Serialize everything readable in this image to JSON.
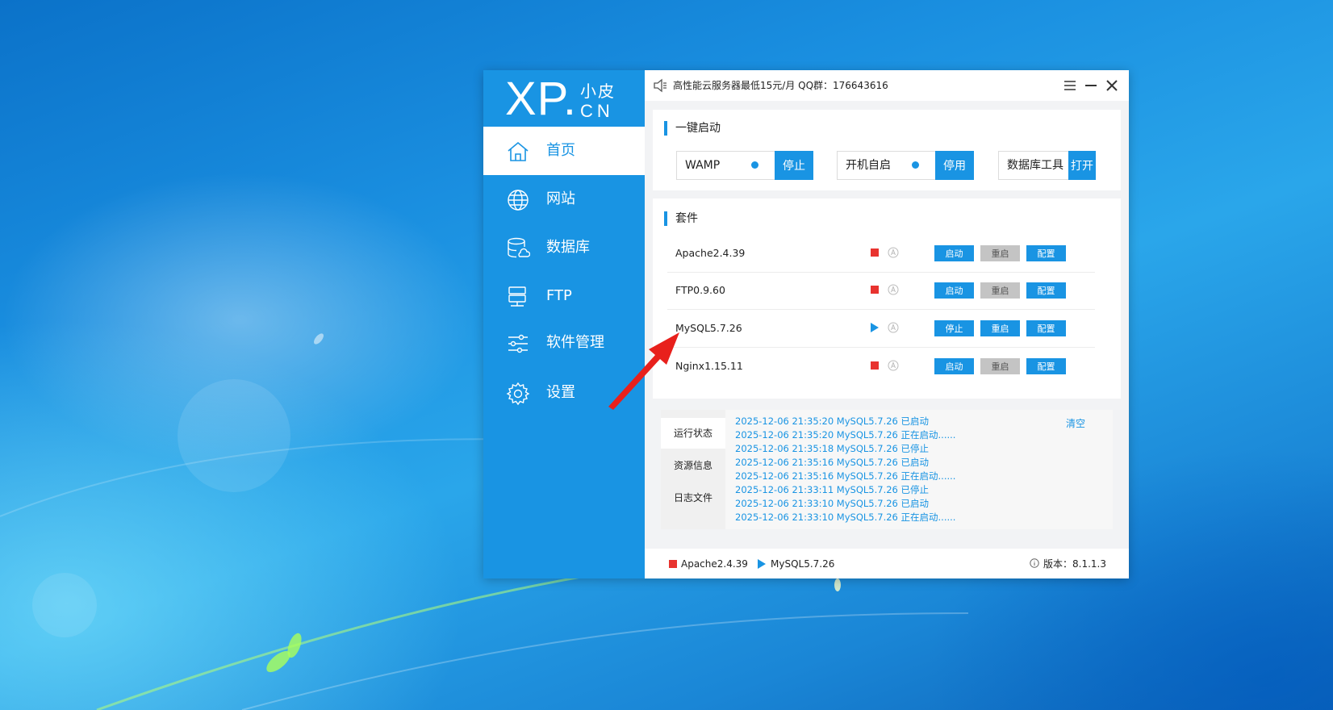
{
  "window": {
    "logo": {
      "main": "XP.",
      "top": "小皮",
      "bottom": "CN"
    },
    "notice": "高性能云服务器最低15元/月 QQ群：176643616"
  },
  "sidebar": {
    "items": [
      {
        "label": "首页",
        "icon": "home-icon",
        "active": true
      },
      {
        "label": "网站",
        "icon": "globe-icon"
      },
      {
        "label": "数据库",
        "icon": "database-icon"
      },
      {
        "label": "FTP",
        "icon": "ftp-icon"
      },
      {
        "label": "软件管理",
        "icon": "sliders-icon"
      },
      {
        "label": "设置",
        "icon": "gear-icon"
      }
    ]
  },
  "quick_start": {
    "title": "一键启动",
    "items": [
      {
        "label": "WAMP",
        "button": "停止"
      },
      {
        "label": "开机自启",
        "button": "停用"
      },
      {
        "label": "数据库工具",
        "button": "打开"
      }
    ]
  },
  "suite": {
    "title": "套件",
    "rows": [
      {
        "name": "Apache2.4.39",
        "status": "stopped",
        "b1": "启动",
        "b2": "重启",
        "b3": "配置"
      },
      {
        "name": "FTP0.9.60",
        "status": "stopped",
        "b1": "启动",
        "b2": "重启",
        "b3": "配置"
      },
      {
        "name": "MySQL5.7.26",
        "status": "running",
        "b1": "停止",
        "b2": "重启",
        "b3": "配置"
      },
      {
        "name": "Nginx1.15.11",
        "status": "stopped",
        "b1": "启动",
        "b2": "重启",
        "b3": "配置"
      }
    ]
  },
  "log": {
    "tabs": [
      "运行状态",
      "资源信息",
      "日志文件"
    ],
    "clear_label": "清空",
    "lines": [
      "2025-12-06 21:35:20 MySQL5.7.26 已启动",
      "2025-12-06 21:35:20 MySQL5.7.26 正在启动......",
      "2025-12-06 21:35:18 MySQL5.7.26 已停止",
      "2025-12-06 21:35:16 MySQL5.7.26 已启动",
      "2025-12-06 21:35:16 MySQL5.7.26 正在启动......",
      "2025-12-06 21:33:11 MySQL5.7.26 已停止",
      "2025-12-06 21:33:10 MySQL5.7.26 已启动",
      "2025-12-06 21:33:10 MySQL5.7.26 正在启动......"
    ]
  },
  "footer": {
    "stopped_item": "Apache2.4.39",
    "running_item": "MySQL5.7.26",
    "version": "版本：8.1.1.3"
  },
  "colors": {
    "accent": "#1994e3",
    "stop": "#e8332f",
    "arrow": "#e8201c"
  }
}
